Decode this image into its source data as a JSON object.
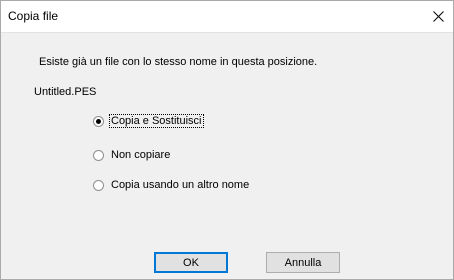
{
  "window": {
    "title": "Copia file"
  },
  "dialog": {
    "message": "Esiste già un file con lo stesso nome in questa posizione.",
    "filename": "Untitled.PES",
    "options": [
      {
        "label": "Copia e Sostituisci",
        "selected": true
      },
      {
        "label": "Non copiare",
        "selected": false
      },
      {
        "label": "Copia usando un altro nome",
        "selected": false
      }
    ]
  },
  "buttons": {
    "ok_label": "OK",
    "cancel_label": "Annulla"
  },
  "colors": {
    "accent": "#0078d7",
    "background": "#f0f0f0"
  }
}
